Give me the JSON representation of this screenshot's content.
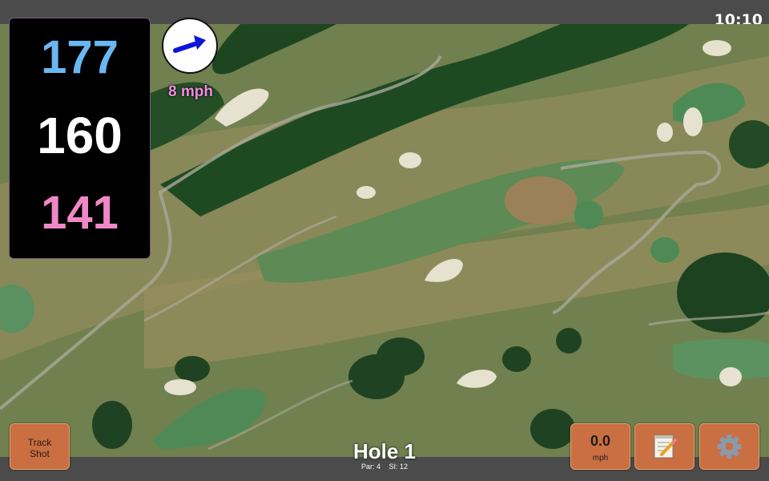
{
  "status_bar": {
    "time": "10:10"
  },
  "distances": {
    "back": "177",
    "middle": "160",
    "front": "141"
  },
  "wind": {
    "speed": "8 mph",
    "icon": "arrow-icon"
  },
  "buttons": {
    "track_shot_label": "Track\nShot",
    "speed_value": "0.0",
    "speed_unit": "mph",
    "notes_icon": "notepad-icon",
    "settings_icon": "gear-icon"
  },
  "hole": {
    "title": "Hole 1",
    "par": "Par: 4",
    "stroke_index": "SI: 12"
  },
  "colors": {
    "back": "#6ab7f2",
    "middle": "#ffffff",
    "front": "#f088c7",
    "wind_text": "#f08ee0",
    "button": "#c96f42"
  }
}
